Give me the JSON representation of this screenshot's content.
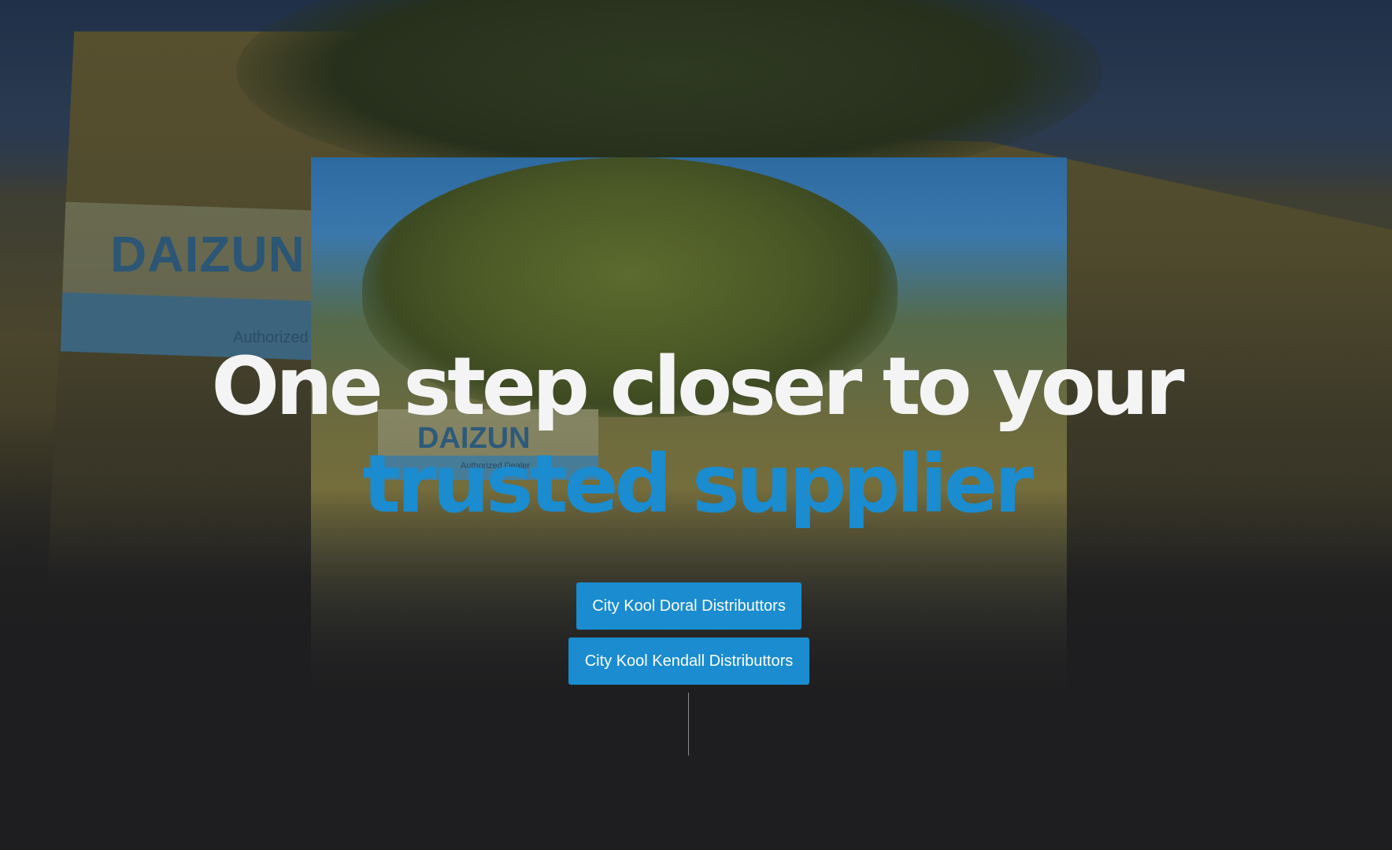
{
  "hero": {
    "headline_line1": "One step closer to your",
    "headline_line2": "trusted supplier",
    "headline_accent_color": "#1a8ccf",
    "background_sign_brand": "DAIZUN",
    "background_sign_subtitle": "Authorized Dealer"
  },
  "buttons": {
    "doral": "City Kool Doral Distributtors",
    "kendall": "City Kool Kendall Distributtors",
    "color": "#1a8ccf"
  },
  "scroll_indicator": "scroll-line"
}
